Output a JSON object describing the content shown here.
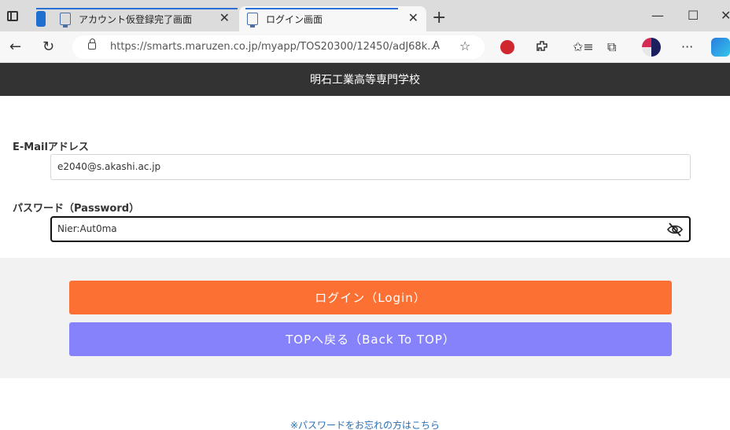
{
  "browser": {
    "tabs": [
      {
        "title": "アカウント仮登録完了画面",
        "close": "✕"
      },
      {
        "title": "ログイン画面",
        "close": "✕"
      }
    ],
    "new_tab": "+",
    "window_controls": {
      "minimize": "—",
      "maximize": "☐",
      "close": "✕"
    },
    "url": "https://smarts.maruzen.co.jp/myapp/TOS20300/12450/adJ68k...",
    "read_aloud": "Áˢ",
    "more": "···",
    "icons": {
      "back": "←",
      "refresh": "↻",
      "favorite_add": "☆",
      "extensions": "puzzle-icon",
      "favorites": "✩≡",
      "collections": "⧉"
    }
  },
  "site": {
    "school_name": "明石工業高等専門学校"
  },
  "form": {
    "email_label": "E-Mailアドレス",
    "email_value": "e2040@s.akashi.ac.jp",
    "password_label": "パスワード（Password）",
    "password_value": "Nier:Aut0ma"
  },
  "buttons": {
    "login": "ログイン（Login）",
    "back_to_top": "TOPへ戻る（Back To TOP）"
  },
  "links": {
    "forgot_password": "※パスワードをお忘れの方はこちら"
  },
  "colors": {
    "header_bg": "#333333",
    "login_button": "#fd7034",
    "top_button": "#8582fc",
    "link": "#2a6fb5"
  }
}
